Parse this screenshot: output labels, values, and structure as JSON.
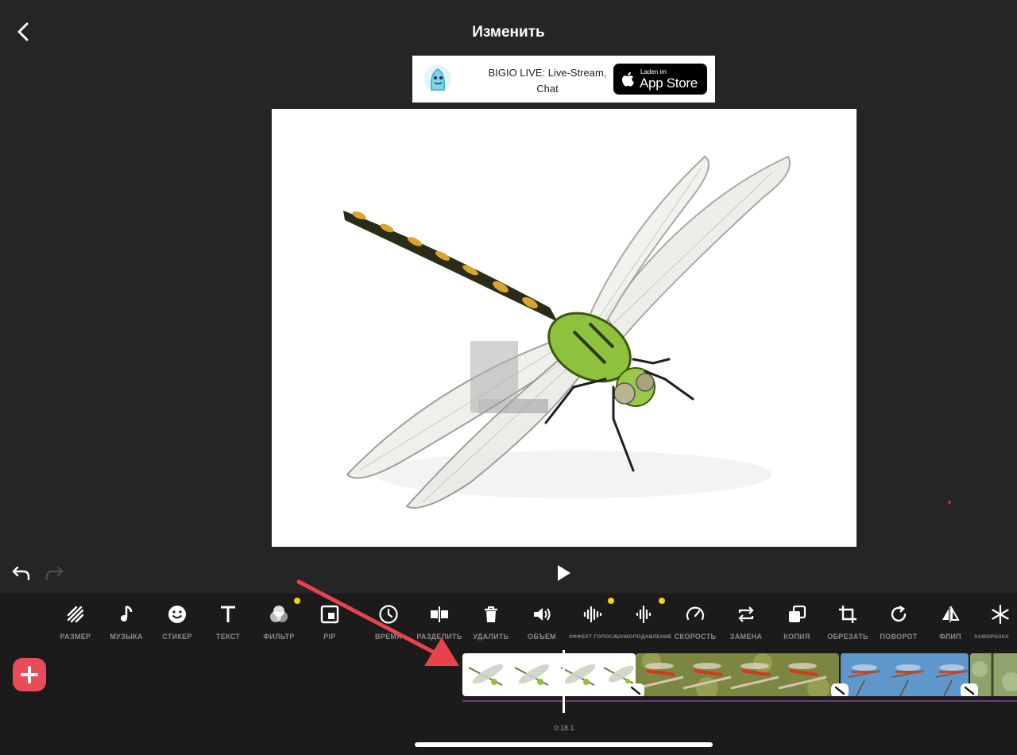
{
  "header": {
    "title": "Изменить",
    "back_icon": "chevron-left-icon"
  },
  "ad": {
    "text_line1": "BIGIO LIVE: Live-Stream,",
    "text_line2": "Chat",
    "store_small": "Laden im",
    "store_big": "App Store"
  },
  "playback": {
    "play_icon": "play-icon",
    "timecode": "0:18.1"
  },
  "tools": [
    {
      "label": "РАЗМЕР",
      "icon": "resize-icon"
    },
    {
      "label": "МУЗЫКА",
      "icon": "music-note-icon"
    },
    {
      "label": "СТИКЕР",
      "icon": "smiley-icon"
    },
    {
      "label": "ТЕКСТ",
      "icon": "text-icon"
    },
    {
      "label": "ФИЛЬТР",
      "icon": "filter-icon"
    },
    {
      "label": "PIP",
      "icon": "pip-icon"
    },
    {
      "label": "ВРЕМЯ",
      "icon": "clock-icon"
    },
    {
      "label": "РАЗДЕЛИТЬ",
      "icon": "split-icon"
    },
    {
      "label": "УДАЛИТЬ",
      "icon": "trash-icon"
    },
    {
      "label": "ОБЪЕМ",
      "icon": "volume-icon"
    },
    {
      "label": "ЭФФЕКТ ГОЛОСА",
      "icon": "voice-effect-icon"
    },
    {
      "label": "ШУМОПОДАВЛЕНИЕ",
      "icon": "denoise-icon"
    },
    {
      "label": "СКОРОСТЬ",
      "icon": "speed-icon"
    },
    {
      "label": "ЗАМЕНА",
      "icon": "replace-icon"
    },
    {
      "label": "КОПИЯ",
      "icon": "copy-icon"
    },
    {
      "label": "ОБРЕЗАТЬ",
      "icon": "crop-icon"
    },
    {
      "label": "ПОВОРОТ",
      "icon": "rotate-icon"
    },
    {
      "label": "ФЛИП",
      "icon": "flip-icon"
    },
    {
      "label": "ЗАМОРОЗКА",
      "icon": "snowflake-icon"
    }
  ],
  "colors": {
    "accent": "#e94b58",
    "new_dot": "#f5d20a",
    "background": "#252525",
    "toolbar_bg": "#1b1b1b",
    "annotation_arrow": "#e8434c"
  }
}
